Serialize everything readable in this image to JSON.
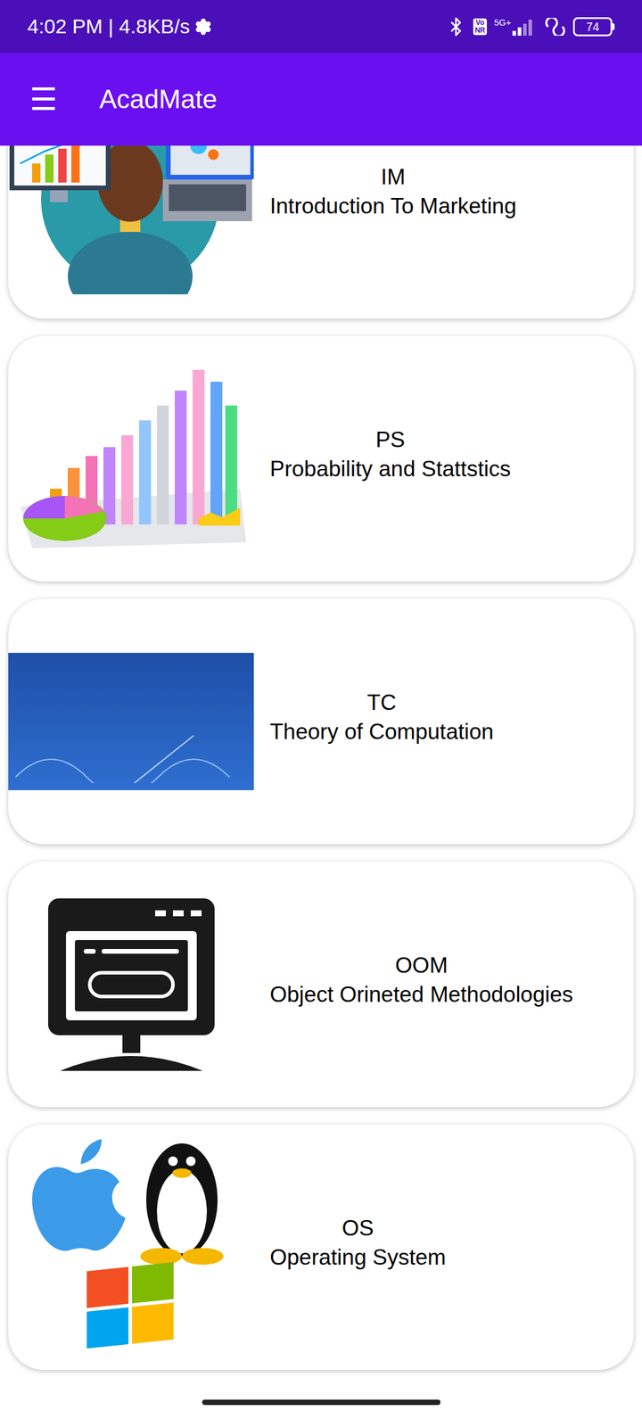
{
  "status_bar": {
    "time": "4:02 PM | 4.8KB/s",
    "volte": [
      "Vo",
      "NR"
    ],
    "network": "5G+",
    "battery": "74"
  },
  "app_bar": {
    "menu_icon": "☰",
    "title": "AcadMate"
  },
  "courses": [
    {
      "code": "IM",
      "title": "Introduction To Marketing",
      "kind": "marketing"
    },
    {
      "code": "PS",
      "title": "Probability and Stattstics",
      "kind": "stats"
    },
    {
      "code": "TC",
      "title": "Theory of Computation",
      "kind": "toc"
    },
    {
      "code": "OOM",
      "title": "Object Orineted Methodologies",
      "kind": "oop"
    },
    {
      "code": "OS",
      "title": "Operating System",
      "kind": "os"
    }
  ]
}
